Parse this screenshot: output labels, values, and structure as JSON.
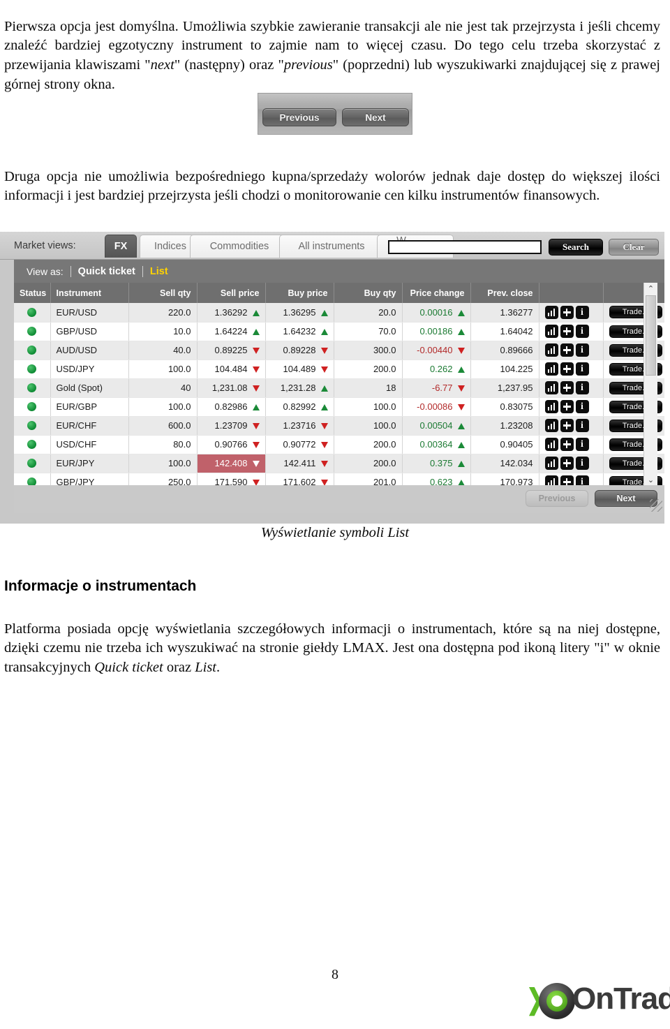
{
  "document": {
    "paragraph_intro": "Pierwsza opcja jest domyślna. Umożliwia szybkie zawieranie transakcji ale nie jest tak przejrzysta i jeśli chcemy znaleźć bardziej egzotyczny instrument to zajmie nam to więcej czasu. Do tego celu trzeba skorzystać z przewijania klawiszami \"next\" (następny) oraz \"previous\" (poprzedni) lub wyszukiwarki znajdującej się z prawej górnej strony okna.",
    "paragraph_intro_parts": {
      "p1": "Pierwsza opcja jest domyślna.",
      "p2": " Umożliwia szybkie zawieranie transakcji ale nie jest tak przejrzysta i jeśli chcemy znaleźć bardziej egzotyczny instrument to zajmie nam to więcej czasu. Do tego celu trzeba skorzystać z przewijania klawiszami \"",
      "next_italic": "next",
      "p3": "\" (następny) oraz \"",
      "previous_italic": "previous",
      "p4": "\" (poprzedni) lub wyszukiwarki znajdującej się z prawej górnej strony okna."
    },
    "paragraph_second": "Druga opcja nie umożliwia bezpośredniego kupna/sprzedaży wolorów jednak daje dostęp do większej ilości informacji i jest bardziej przejrzysta jeśli chodzi o monitorowanie cen kilku instrumentów finansowych.",
    "figure_caption": "Wyświetlanie symboli List",
    "section_heading": "Informacje o instrumentach",
    "paragraph_info_parts": {
      "p1": "Platforma posiada opcję wyświetlania szczegółowych informacji o instrumentach, które są na niej dostępne, dzięki czemu nie trzeba ich wyszukiwać na stronie giełdy LMAX. Jest ona dostępna pod ikoną litery ",
      "i_quoted": "\"i\"",
      "p2": " w oknie transakcyjnych ",
      "quick_ticket_italic": "Quick ticket",
      "p3": " oraz ",
      "list_italic": "List",
      "p4": "."
    },
    "page_number": "8",
    "logo": {
      "chevron": "❯",
      "word": "OnTrade",
      "accent_color": "#5dbb26",
      "text_color": "#3b3b3b"
    }
  },
  "figure_prevnext": {
    "previous_label": "Previous",
    "next_label": "Next"
  },
  "platform": {
    "market_views_label": "Market views:",
    "tabs": [
      {
        "label": "FX",
        "active": true
      },
      {
        "label": "Indices",
        "active": false
      },
      {
        "label": "Commodities",
        "active": false
      },
      {
        "label": "All instruments",
        "active": false
      },
      {
        "label": "W",
        "active": false
      }
    ],
    "search": {
      "value": "",
      "placeholder": "",
      "search_button": "Search",
      "clear_button": "Clear"
    },
    "view_as": {
      "label": "View as:",
      "options": [
        "Quick ticket",
        "List"
      ],
      "selected": "List",
      "selected_color": "#ffd200"
    },
    "table": {
      "columns": [
        {
          "key": "status",
          "label": "Status",
          "align": "left"
        },
        {
          "key": "instrument",
          "label": "Instrument",
          "align": "left"
        },
        {
          "key": "sell_qty",
          "label": "Sell qty",
          "align": "right"
        },
        {
          "key": "sell_price",
          "label": "Sell price",
          "align": "right"
        },
        {
          "key": "buy_price",
          "label": "Buy price",
          "align": "right"
        },
        {
          "key": "buy_qty",
          "label": "Buy qty",
          "align": "right"
        },
        {
          "key": "price_change",
          "label": "Price change",
          "align": "right"
        },
        {
          "key": "prev_close",
          "label": "Prev. close",
          "align": "right"
        },
        {
          "key": "icons",
          "label": "",
          "align": "left"
        },
        {
          "key": "trade",
          "label": "",
          "align": "left"
        }
      ],
      "trade_button_label": "Trade...",
      "row_icons": [
        "chart-icon",
        "plus-icon",
        "info-icon"
      ],
      "info_icon_glyph": "i",
      "rows": [
        {
          "status": "online",
          "instrument": "EUR/USD",
          "sell_qty": "220.0",
          "sell_price": "1.36292",
          "sell_dir": "up",
          "buy_price": "1.36295",
          "buy_dir": "up",
          "buy_qty": "20.0",
          "price_change": "0.00016",
          "change_dir": "up",
          "prev_close": "1.36277",
          "highlight": ""
        },
        {
          "status": "online",
          "instrument": "GBP/USD",
          "sell_qty": "10.0",
          "sell_price": "1.64224",
          "sell_dir": "up",
          "buy_price": "1.64232",
          "buy_dir": "up",
          "buy_qty": "70.0",
          "price_change": "0.00186",
          "change_dir": "up",
          "prev_close": "1.64042",
          "highlight": ""
        },
        {
          "status": "online",
          "instrument": "AUD/USD",
          "sell_qty": "40.0",
          "sell_price": "0.89225",
          "sell_dir": "down",
          "buy_price": "0.89228",
          "buy_dir": "down",
          "buy_qty": "300.0",
          "price_change": "-0.00440",
          "change_dir": "down",
          "prev_close": "0.89666",
          "highlight": ""
        },
        {
          "status": "online",
          "instrument": "USD/JPY",
          "sell_qty": "100.0",
          "sell_price": "104.484",
          "sell_dir": "down",
          "buy_price": "104.489",
          "buy_dir": "down",
          "buy_qty": "200.0",
          "price_change": "0.262",
          "change_dir": "up",
          "prev_close": "104.225",
          "highlight": ""
        },
        {
          "status": "online",
          "instrument": "Gold (Spot)",
          "sell_qty": "40",
          "sell_price": "1,231.08",
          "sell_dir": "down",
          "buy_price": "1,231.28",
          "buy_dir": "up",
          "buy_qty": "18",
          "price_change": "-6.77",
          "change_dir": "down",
          "prev_close": "1,237.95",
          "highlight": ""
        },
        {
          "status": "online",
          "instrument": "EUR/GBP",
          "sell_qty": "100.0",
          "sell_price": "0.82986",
          "sell_dir": "up",
          "buy_price": "0.82992",
          "buy_dir": "up",
          "buy_qty": "100.0",
          "price_change": "-0.00086",
          "change_dir": "down",
          "prev_close": "0.83075",
          "highlight": ""
        },
        {
          "status": "online",
          "instrument": "EUR/CHF",
          "sell_qty": "600.0",
          "sell_price": "1.23709",
          "sell_dir": "down",
          "buy_price": "1.23716",
          "buy_dir": "down",
          "buy_qty": "100.0",
          "price_change": "0.00504",
          "change_dir": "up",
          "prev_close": "1.23208",
          "highlight": ""
        },
        {
          "status": "online",
          "instrument": "USD/CHF",
          "sell_qty": "80.0",
          "sell_price": "0.90766",
          "sell_dir": "down",
          "buy_price": "0.90772",
          "buy_dir": "down",
          "buy_qty": "200.0",
          "price_change": "0.00364",
          "change_dir": "up",
          "prev_close": "0.90405",
          "highlight": ""
        },
        {
          "status": "online",
          "instrument": "EUR/JPY",
          "sell_qty": "100.0",
          "sell_price": "142.408",
          "sell_dir": "down",
          "buy_price": "142.411",
          "buy_dir": "down",
          "buy_qty": "200.0",
          "price_change": "0.375",
          "change_dir": "up",
          "prev_close": "142.034",
          "highlight": "sell_price_down"
        },
        {
          "status": "online",
          "instrument": "GBP/JPY",
          "sell_qty": "250.0",
          "sell_price": "171.590",
          "sell_dir": "down",
          "buy_price": "171.602",
          "buy_dir": "down",
          "buy_qty": "201.0",
          "price_change": "0.623",
          "change_dir": "up",
          "prev_close": "170.973",
          "highlight": ""
        }
      ]
    },
    "pager": {
      "previous_label": "Previous",
      "previous_enabled": false,
      "next_label": "Next",
      "next_enabled": true
    },
    "scrollbar": {
      "up_glyph": "⌃",
      "down_glyph": "⌄"
    },
    "colors": {
      "sell_price": "#8a1f2e",
      "buy_price": "#2554a8",
      "up": "#1b8a38",
      "down": "#cf2121",
      "header_bg": "#6f6f6f",
      "flash_down_bg": "#c0616a",
      "status_dot": "#0d8a33"
    }
  }
}
